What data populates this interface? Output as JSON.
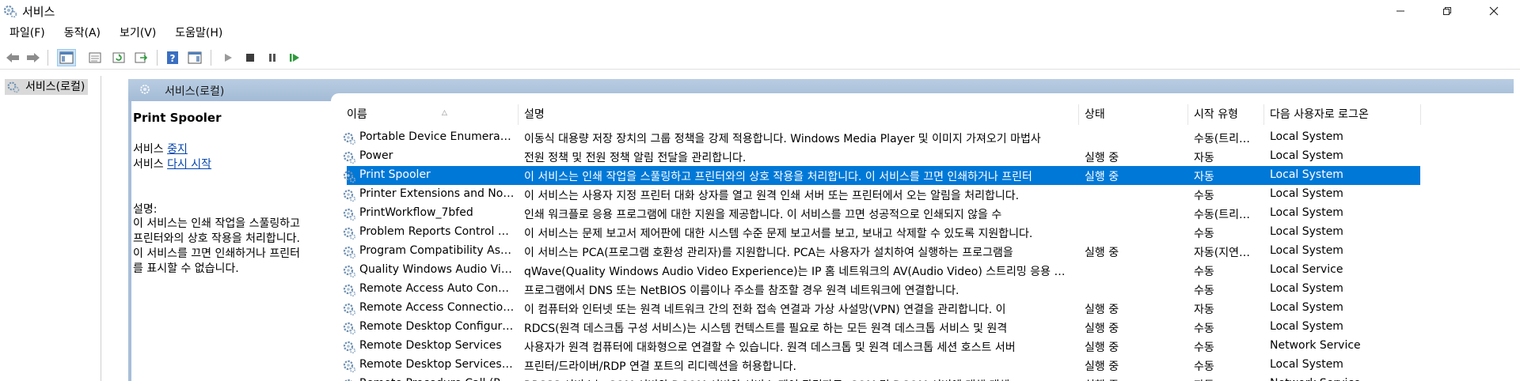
{
  "window": {
    "title": "서비스"
  },
  "menu": [
    "파일(F)",
    "동작(A)",
    "보기(V)",
    "도움말(H)"
  ],
  "tree": {
    "root_label": "서비스(로컬)"
  },
  "panel": {
    "header": "서비스(로컬)"
  },
  "details": {
    "service_title": "Print Spooler",
    "action_prefix": "서비스",
    "stop_link": "중지",
    "restart_link": "다시 시작",
    "desc_label": "설명:",
    "desc_lines": [
      "이 서비스는 인쇄 작업을 스풀링하고",
      "프린터와의 상호 작용을 처리합니다.",
      "이 서비스를 끄면 인쇄하거나 프린터",
      "를 표시할 수 없습니다."
    ]
  },
  "table": {
    "columns": [
      "이름",
      "설명",
      "상태",
      "시작 유형",
      "다음 사용자로 로그온"
    ],
    "rows": [
      {
        "name": "Portable Device Enumerator Service",
        "desc": "이동식 대용량 저장 장치의 그룹 정책을 강제 적용합니다. Windows Media Player 및 이미지 가져오기 마법사",
        "status": "",
        "start": "수동(트리거 시작)",
        "logon": "Local System"
      },
      {
        "name": "Power",
        "desc": "전원 정책 및 전원 정책 알림 전달을 관리합니다.",
        "status": "실행 중",
        "start": "자동",
        "logon": "Local System"
      },
      {
        "name": "Print Spooler",
        "desc": "이 서비스는 인쇄 작업을 스풀링하고 프린터와의 상호 작용을 처리합니다. 이 서비스를 끄면 인쇄하거나 프린터",
        "status": "실행 중",
        "start": "자동",
        "logon": "Local System",
        "selected": true
      },
      {
        "name": "Printer Extensions and Notifications",
        "desc": "이 서비스는 사용자 지정 프린터 대화 상자를 열고 원격 인쇄 서버 또는 프린터에서 오는 알림을 처리합니다.",
        "status": "",
        "start": "수동",
        "logon": "Local System"
      },
      {
        "name": "PrintWorkflow_7bfed",
        "desc": "인쇄 워크플로 응용 프로그램에 대한 지원을 제공합니다. 이 서비스를 끄면 성공적으로 인쇄되지 않을 수",
        "status": "",
        "start": "수동(트리거 시작)",
        "logon": "Local System"
      },
      {
        "name": "Problem Reports Control Panel Support",
        "desc": "이 서비스는 문제 보고서 제어판에 대한 시스템 수준 문제 보고서를 보고, 보내고 삭제할 수 있도록 지원합니다.",
        "status": "",
        "start": "수동",
        "logon": "Local System"
      },
      {
        "name": "Program Compatibility Assistant Service",
        "desc": "이 서비스는 PCA(프로그램 호환성 관리자)를 지원합니다. PCA는 사용자가 설치하여 실행하는 프로그램을",
        "status": "실행 중",
        "start": "자동(지연된 시작)",
        "logon": "Local System"
      },
      {
        "name": "Quality Windows Audio Video Experience",
        "desc": "qWave(Quality Windows Audio Video Experience)는 IP 홈 네트워크의 AV(Audio Video) 스트리밍 응용 프로그램",
        "status": "",
        "start": "수동",
        "logon": "Local Service"
      },
      {
        "name": "Remote Access Auto Connection Manager",
        "desc": "프로그램에서 DNS 또는 NetBIOS 이름이나 주소를 참조할 경우 원격 네트워크에 연결합니다.",
        "status": "",
        "start": "수동",
        "logon": "Local System"
      },
      {
        "name": "Remote Access Connection Manager",
        "desc": "이 컴퓨터와 인터넷 또는 원격 네트워크 간의 전화 접속 연결과 가상 사설망(VPN) 연결을 관리합니다. 이",
        "status": "실행 중",
        "start": "자동",
        "logon": "Local System"
      },
      {
        "name": "Remote Desktop Configuration",
        "desc": "RDCS(원격 데스크톱 구성 서비스)는 시스템 컨텍스트를 필요로 하는 모든 원격 데스크톱 서비스 및 원격",
        "status": "실행 중",
        "start": "수동",
        "logon": "Local System"
      },
      {
        "name": "Remote Desktop Services",
        "desc": "사용자가 원격 컴퓨터에 대화형으로 연결할 수 있습니다. 원격 데스크톱 및 원격 데스크톱 세션 호스트 서버",
        "status": "실행 중",
        "start": "수동",
        "logon": "Network Service"
      },
      {
        "name": "Remote Desktop Services UserMode Port Redirector",
        "desc": "프린터/드라이버/RDP 연결 포트의 리디렉션을 허용합니다.",
        "status": "실행 중",
        "start": "수동",
        "logon": "Local System"
      },
      {
        "name": "Remote Procedure Call (RPC)",
        "desc": "RPCSS 서비스는 COM 서버와 DCOM 서버의 서비스 제어 관리자로, COM 및 DCOM 서버에 대해 개체",
        "status": "실행 중",
        "start": "자동",
        "logon": "Network Service"
      }
    ]
  }
}
